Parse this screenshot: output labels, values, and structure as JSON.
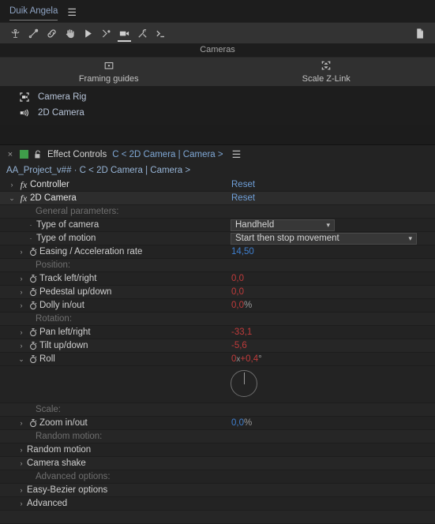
{
  "duik": {
    "tab_label": "Duik Angela",
    "menu_icon": "hamburger-menu-icon",
    "toolbar": [
      {
        "name": "rigging-icon",
        "title": "Rigging"
      },
      {
        "name": "bone-icon",
        "title": "Bones"
      },
      {
        "name": "link-icon",
        "title": "Links & constraints"
      },
      {
        "name": "hand-icon",
        "title": "Automation"
      },
      {
        "name": "play-icon",
        "title": "Animation"
      },
      {
        "name": "keyframe-icon",
        "title": "Keyframes"
      },
      {
        "name": "camera-icon",
        "title": "Cameras",
        "active": true
      },
      {
        "name": "tools-icon",
        "title": "Tools"
      },
      {
        "name": "console-icon",
        "title": "Console"
      }
    ],
    "toolbar_right_icon": "document-icon",
    "section_title": "Cameras",
    "buttons": [
      {
        "label": "Framing guides",
        "icon": "framing-guides-icon"
      },
      {
        "label": "Scale Z-Link",
        "icon": "scale-zlink-icon"
      }
    ],
    "items": [
      {
        "label": "Camera Rig",
        "icon": "camera-rig-icon"
      },
      {
        "label": "2D Camera",
        "icon": "2d-camera-icon"
      }
    ]
  },
  "effect_controls": {
    "close_glyph": "×",
    "swatch_color": "#3f9d4a",
    "lock_icon": "lock-icon",
    "title": "Effect Controls",
    "subject": "C < 2D Camera | Camera >",
    "menu_icon": "hamburger-menu-icon",
    "breadcrumb": "AA_Project_v## · C < 2D Camera | Camera >",
    "reset_label": "Reset",
    "effects": [
      {
        "name": "Controller",
        "expanded": false,
        "reset": "Reset"
      },
      {
        "name": "2D Camera",
        "expanded": true,
        "reset": "Reset"
      }
    ],
    "groups": {
      "general": "General parameters:",
      "position": "Position:",
      "rotation": "Rotation:",
      "scale": "Scale:",
      "random_motion": "Random motion:",
      "advanced_options": "Advanced options:"
    },
    "params": {
      "type_of_camera": {
        "label": "Type of camera",
        "value": "Handheld"
      },
      "type_of_motion": {
        "label": "Type of motion",
        "value": "Start then stop movement"
      },
      "easing": {
        "label": "Easing / Acceleration rate",
        "value": "14,50"
      },
      "track": {
        "label": "Track left/right",
        "value": "0,0"
      },
      "pedestal": {
        "label": "Pedestal up/down",
        "value": "0,0"
      },
      "dolly": {
        "label": "Dolly in/out",
        "value": "0,0",
        "unit": "%"
      },
      "pan": {
        "label": "Pan left/right",
        "value": "-33,1"
      },
      "tilt": {
        "label": "Tilt up/down",
        "value": "-5,6"
      },
      "roll": {
        "label": "Roll",
        "revolutions": "0",
        "x": "x",
        "value": "+0,4",
        "unit": "°"
      },
      "zoom": {
        "label": "Zoom in/out",
        "value": "0,0",
        "unit": "%"
      },
      "random_motion": {
        "label": "Random motion"
      },
      "camera_shake": {
        "label": "Camera shake"
      },
      "easy_bezier": {
        "label": "Easy-Bezier options"
      },
      "advanced": {
        "label": "Advanced"
      }
    },
    "chevrons": {
      "collapsed": "›",
      "expanded": "⌄"
    }
  },
  "colors": {
    "value_keyframed": "#c03b3b",
    "value_expression": "#3f7fcf",
    "link": "#6f9fd8",
    "panel_bg": "#232323",
    "toolbar_bg": "#333333"
  }
}
